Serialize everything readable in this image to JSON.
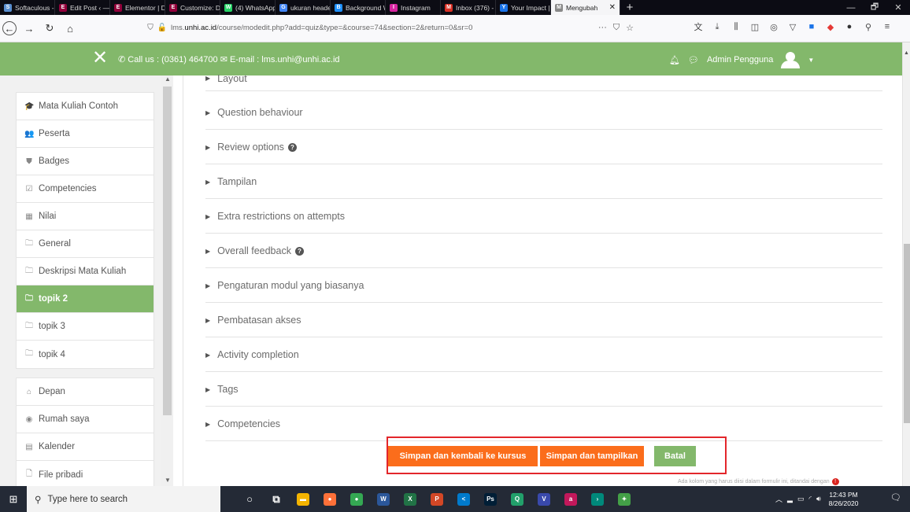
{
  "browser": {
    "tabs": [
      {
        "label": "Softaculous - S",
        "color": "#5a8fd0",
        "glyph": "S",
        "icon": "softaculous-icon"
      },
      {
        "label": "Edit Post ‹ — V",
        "color": "#92003b",
        "glyph": "E",
        "icon": "elementor-icon"
      },
      {
        "label": "Elementor | Do",
        "color": "#92003b",
        "glyph": "E",
        "icon": "elementor-icon"
      },
      {
        "label": "Customize: Do",
        "color": "#92003b",
        "glyph": "E",
        "icon": "elementor-icon"
      },
      {
        "label": "(4) WhatsApp",
        "color": "#25d366",
        "glyph": "W",
        "icon": "whatsapp-icon"
      },
      {
        "label": "ukuran header",
        "color": "#4285f4",
        "glyph": "G",
        "icon": "google-icon"
      },
      {
        "label": "Background We",
        "color": "#1e90ff",
        "glyph": "B",
        "icon": "background-icon"
      },
      {
        "label": "Instagram",
        "color": "#d6249f",
        "glyph": "I",
        "icon": "instagram-icon"
      },
      {
        "label": "Inbox (376) - l",
        "color": "#d93025",
        "glyph": "M",
        "icon": "gmail-icon"
      },
      {
        "label": "Your Impact | T",
        "color": "#1a73e8",
        "glyph": "Y",
        "icon": "impact-icon"
      },
      {
        "label": "Mengubah",
        "color": "#888888",
        "glyph": "M",
        "icon": "moodle-icon",
        "active": true
      }
    ],
    "url_prefix": "lms.",
    "url_domain": "unhi.ac.id",
    "url_path": "/course/modedit.php?add=quiz&type=&course=74&section=2&return=0&sr=0"
  },
  "header": {
    "contact": "Call us : (0361) 464700 ✉ E-mail : lms.unhi@unhi.ac.id",
    "user": "Admin Pengguna"
  },
  "sidebar": {
    "group1": [
      {
        "label": "Mata Kuliah Contoh",
        "icon": "graduation-cap-icon",
        "glyph": "🎓"
      },
      {
        "label": "Peserta",
        "icon": "users-icon",
        "glyph": "👥"
      },
      {
        "label": "Badges",
        "icon": "shield-icon",
        "glyph": "⛊"
      },
      {
        "label": "Competencies",
        "icon": "check-square-icon",
        "glyph": "☑"
      },
      {
        "label": "Nilai",
        "icon": "table-icon",
        "glyph": "▦"
      },
      {
        "label": "General",
        "icon": "folder-icon",
        "glyph": "🗀"
      },
      {
        "label": "Deskripsi Mata Kuliah",
        "icon": "folder-icon",
        "glyph": "🗀"
      },
      {
        "label": "topik 2",
        "icon": "folder-icon",
        "glyph": "🗀",
        "active": true
      },
      {
        "label": "topik 3",
        "icon": "folder-icon",
        "glyph": "🗀"
      },
      {
        "label": "topik 4",
        "icon": "folder-icon",
        "glyph": "🗀"
      }
    ],
    "group2": [
      {
        "label": "Depan",
        "icon": "home-icon",
        "glyph": "⌂"
      },
      {
        "label": "Rumah saya",
        "icon": "dashboard-icon",
        "glyph": "◉"
      },
      {
        "label": "Kalender",
        "icon": "calendar-icon",
        "glyph": "▤"
      },
      {
        "label": "File pribadi",
        "icon": "file-icon",
        "glyph": "🗋"
      }
    ]
  },
  "sections": [
    {
      "label": "Layout",
      "help": false
    },
    {
      "label": "Question behaviour",
      "help": false
    },
    {
      "label": "Review options",
      "help": true
    },
    {
      "label": "Tampilan",
      "help": false
    },
    {
      "label": "Extra restrictions on attempts",
      "help": false
    },
    {
      "label": "Overall feedback",
      "help": true
    },
    {
      "label": "Pengaturan modul yang biasanya",
      "help": false
    },
    {
      "label": "Pembatasan akses",
      "help": false
    },
    {
      "label": "Activity completion",
      "help": false
    },
    {
      "label": "Tags",
      "help": false
    },
    {
      "label": "Competencies",
      "help": false
    }
  ],
  "buttons": {
    "save_return": "Simpan dan kembali ke kursus",
    "save_display": "Simpan dan tampilkan",
    "cancel": "Batal"
  },
  "required_note": "Ada kolom yang harus diisi dalam formulir ini, ditandai dengan",
  "taskbar": {
    "search_placeholder": "Type here to search",
    "time": "12:43 PM",
    "date": "8/26/2020",
    "apps": [
      {
        "icon": "cortana-icon",
        "glyph": "○",
        "color": "transparent"
      },
      {
        "icon": "task-view-icon",
        "glyph": "⧉",
        "color": "transparent"
      },
      {
        "icon": "file-explorer-icon",
        "glyph": "▬",
        "color": "#f4b400"
      },
      {
        "icon": "firefox-icon",
        "glyph": "●",
        "color": "#ff7139"
      },
      {
        "icon": "chrome-icon",
        "glyph": "●",
        "color": "#34a853"
      },
      {
        "icon": "word-icon",
        "glyph": "W",
        "color": "#2b579a"
      },
      {
        "icon": "excel-icon",
        "glyph": "X",
        "color": "#217346"
      },
      {
        "icon": "powerpoint-icon",
        "glyph": "P",
        "color": "#d24726"
      },
      {
        "icon": "vscode-icon",
        "glyph": "<",
        "color": "#007acc"
      },
      {
        "icon": "photoshop-icon",
        "glyph": "Ps",
        "color": "#001e36"
      },
      {
        "icon": "app-icon",
        "glyph": "Q",
        "color": "#22a06b"
      },
      {
        "icon": "v-app-icon",
        "glyph": "V",
        "color": "#3949ab"
      },
      {
        "icon": "a-app-icon",
        "glyph": "a",
        "color": "#c2185b"
      },
      {
        "icon": "arrow-app-icon",
        "glyph": "›",
        "color": "#00897b"
      },
      {
        "icon": "feather-app-icon",
        "glyph": "✦",
        "color": "#43a047"
      }
    ]
  }
}
